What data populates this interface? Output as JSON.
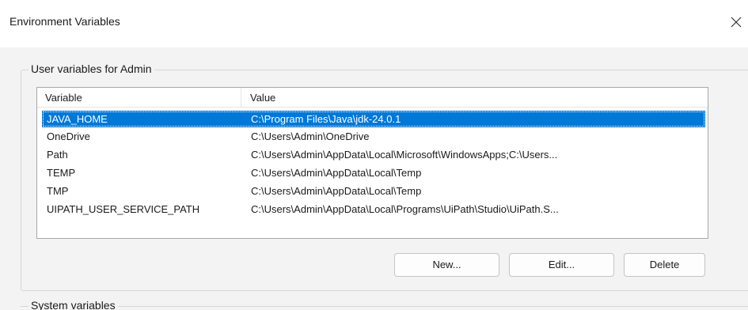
{
  "window": {
    "title": "Environment Variables",
    "close_glyph": "×"
  },
  "user_vars": {
    "group_label": "User variables for Admin",
    "columns": [
      "Variable",
      "Value"
    ],
    "rows": [
      {
        "variable": "JAVA_HOME",
        "value": "C:\\Program Files\\Java\\jdk-24.0.1",
        "selected": true
      },
      {
        "variable": "OneDrive",
        "value": "C:\\Users\\Admin\\OneDrive",
        "selected": false
      },
      {
        "variable": "Path",
        "value": "C:\\Users\\Admin\\AppData\\Local\\Microsoft\\WindowsApps;C:\\Users...",
        "selected": false
      },
      {
        "variable": "TEMP",
        "value": "C:\\Users\\Admin\\AppData\\Local\\Temp",
        "selected": false
      },
      {
        "variable": "TMP",
        "value": "C:\\Users\\Admin\\AppData\\Local\\Temp",
        "selected": false
      },
      {
        "variable": "UIPATH_USER_SERVICE_PATH",
        "value": "C:\\Users\\Admin\\AppData\\Local\\Programs\\UiPath\\Studio\\UiPath.S...",
        "selected": false
      }
    ],
    "buttons": {
      "new_label": "New...",
      "edit_label": "Edit...",
      "delete_label": "Delete"
    }
  },
  "system_vars": {
    "group_label": "System variables"
  },
  "colors": {
    "selection": "#0078d7",
    "dialog_bg": "#f3f3f3"
  },
  "icons": {
    "close": "close-icon"
  }
}
